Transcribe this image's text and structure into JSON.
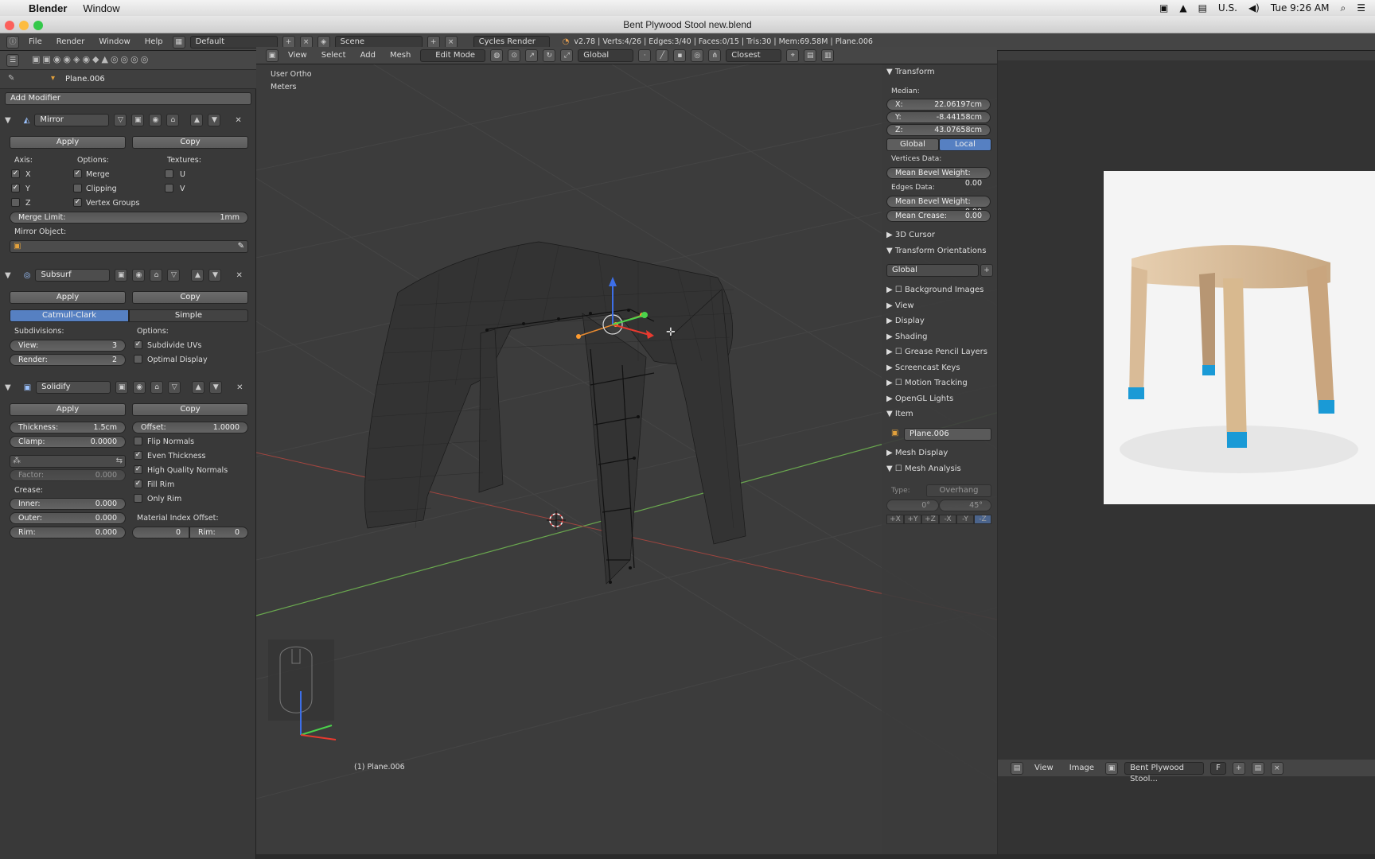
{
  "macbar": {
    "app": "Blender",
    "menu": "Window",
    "input_source": "U.S.",
    "clock": "Tue 9:26 AM"
  },
  "window": {
    "title": "Bent Plywood Stool new.blend"
  },
  "info_header": {
    "menus": [
      "File",
      "Render",
      "Window",
      "Help"
    ],
    "layout": "Default",
    "scene": "Scene",
    "engine": "Cycles Render",
    "stats": "v2.78 | Verts:4/26 | Edges:3/40 | Faces:0/15 | Tris:30 | Mem:69.58M | Plane.006"
  },
  "props": {
    "object": "Plane.006",
    "add_modifier": "Add Modifier",
    "mirror": {
      "name": "Mirror",
      "apply": "Apply",
      "copy": "Copy",
      "axis_label": "Axis:",
      "options_label": "Options:",
      "textures_label": "Textures:",
      "x": "X",
      "y": "Y",
      "z": "Z",
      "merge": "Merge",
      "clipping": "Clipping",
      "vgroups": "Vertex Groups",
      "u": "U",
      "v": "V",
      "merge_limit_label": "Merge Limit:",
      "merge_limit": "1mm",
      "mirror_object": "Mirror Object:"
    },
    "subsurf": {
      "name": "Subsurf",
      "apply": "Apply",
      "copy": "Copy",
      "catmull": "Catmull-Clark",
      "simple": "Simple",
      "subdivisions": "Subdivisions:",
      "options": "Options:",
      "view_label": "View:",
      "view": "3",
      "render_label": "Render:",
      "render": "2",
      "subdiv_uvs": "Subdivide UVs",
      "optimal": "Optimal Display"
    },
    "solidify": {
      "name": "Solidify",
      "apply": "Apply",
      "copy": "Copy",
      "thickness_label": "Thickness:",
      "thickness": "1.5cm",
      "offset_label": "Offset:",
      "offset": "1.0000",
      "clamp_label": "Clamp:",
      "clamp": "0.0000",
      "factor_label": "Factor:",
      "factor": "0.000",
      "crease": "Crease:",
      "inner_label": "Inner:",
      "inner": "0.000",
      "outer_label": "Outer:",
      "outer": "0.000",
      "rim_label": "Rim:",
      "rim": "0.000",
      "flip": "Flip Normals",
      "even": "Even Thickness",
      "hq": "High Quality Normals",
      "fillrim": "Fill Rim",
      "onlyrim": "Only Rim",
      "mat_offset": "Material Index Offset:",
      "mat_a": "0",
      "mat_rim_label": "Rim:",
      "mat_b": "0"
    }
  },
  "viewport": {
    "menus": [
      "View",
      "Select",
      "Add",
      "Mesh"
    ],
    "mode": "Edit Mode",
    "orientation": "Global",
    "snap": "Closest",
    "view_name": "User Ortho",
    "units": "Meters",
    "status": "(1) Plane.006"
  },
  "npanel": {
    "transform": "Transform",
    "median": "Median:",
    "x_label": "X:",
    "x": "22.06197cm",
    "y_label": "Y:",
    "y": "-8.44158cm",
    "z_label": "Z:",
    "z": "43.07658cm",
    "global": "Global",
    "local": "Local",
    "vdata": "Vertices Data:",
    "edata": "Edges Data:",
    "mbw_label": "Mean Bevel Weight:",
    "mbw_v": "0.00",
    "mbw_e": "0.00",
    "crease_label": "Mean Crease:",
    "crease": "0.00",
    "sections": [
      "3D Cursor",
      "Transform Orientations"
    ],
    "orient": "Global",
    "panels": [
      "Background Images",
      "View",
      "Display",
      "Shading",
      "Grease Pencil Layers",
      "Screencast Keys",
      "Motion Tracking",
      "OpenGL Lights",
      "Item"
    ],
    "item_name": "Plane.006",
    "mesh_display": "Mesh Display",
    "mesh_analysis": "Mesh Analysis",
    "type_label": "Type:",
    "type": "Overhang",
    "ang_a": "0°",
    "ang_b": "45°",
    "axes": [
      "+X",
      "+Y",
      "+Z",
      "-X",
      "-Y",
      "-Z"
    ]
  },
  "image_editor": {
    "menus": [
      "View",
      "Image"
    ],
    "image_name": "Bent Plywood Stool...",
    "fake": "F"
  },
  "colors": {
    "accent": "#5680c2",
    "bg": "#393939",
    "viewport": "#3c3c3c"
  }
}
